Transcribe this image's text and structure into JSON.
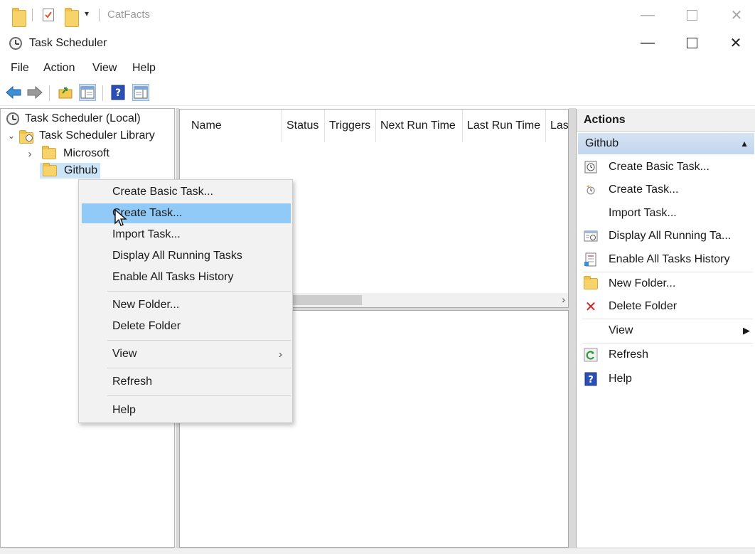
{
  "bg_window": {
    "title": "CatFacts"
  },
  "app": {
    "title": "Task Scheduler"
  },
  "menubar": {
    "items": [
      "File",
      "Action",
      "View",
      "Help"
    ]
  },
  "tree": {
    "root": "Task Scheduler (Local)",
    "library": "Task Scheduler Library",
    "microsoft": "Microsoft",
    "github": "Github"
  },
  "task_list": {
    "columns": [
      "Name",
      "Status",
      "Triggers",
      "Next Run Time",
      "Last Run Time",
      "Las"
    ]
  },
  "actions": {
    "header": "Actions",
    "group": "Github",
    "items": [
      "Create Basic Task...",
      "Create Task...",
      "Import Task...",
      "Display All Running Ta...",
      "Enable All Tasks History",
      "New Folder...",
      "Delete Folder",
      "View",
      "Refresh",
      "Help"
    ]
  },
  "context_menu": {
    "items": [
      "Create Basic Task...",
      "Create Task...",
      "Import Task...",
      "Display All Running Tasks",
      "Enable All Tasks History",
      "New Folder...",
      "Delete Folder",
      "View",
      "Refresh",
      "Help"
    ],
    "highlighted": "Create Task..."
  },
  "colors": {
    "selection": "#91c9f7",
    "tree_selection": "#cce4f7",
    "actions_group": "#c3d6ee"
  },
  "icons": {
    "back": "back-arrow-icon",
    "forward": "forward-arrow-icon",
    "up": "folder-up-icon",
    "show_hide": "console-tree-icon",
    "help": "help-icon",
    "action_pane": "action-pane-icon"
  }
}
